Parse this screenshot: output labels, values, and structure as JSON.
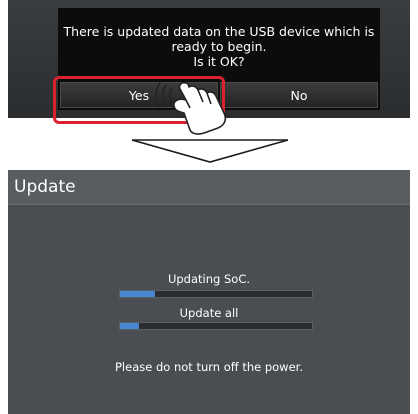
{
  "dialog": {
    "message": "There is updated data on the USB device which is\nready to begin.\nIs it OK?",
    "yes_label": "Yes",
    "no_label": "No"
  },
  "update_screen": {
    "title": "Update",
    "progress": [
      {
        "label": "Updating SoC.",
        "percent": 18
      },
      {
        "label": "Update all",
        "percent": 10
      }
    ],
    "notice": "Please do not turn off the power."
  },
  "colors": {
    "highlight": "#d8222d",
    "progress_fill": "#4a86d6",
    "dialog_bg": "#0c0c0c",
    "screen_bg": "#4a4d52"
  },
  "icons": [
    "pointing-hand-icon",
    "down-arrow-icon"
  ]
}
